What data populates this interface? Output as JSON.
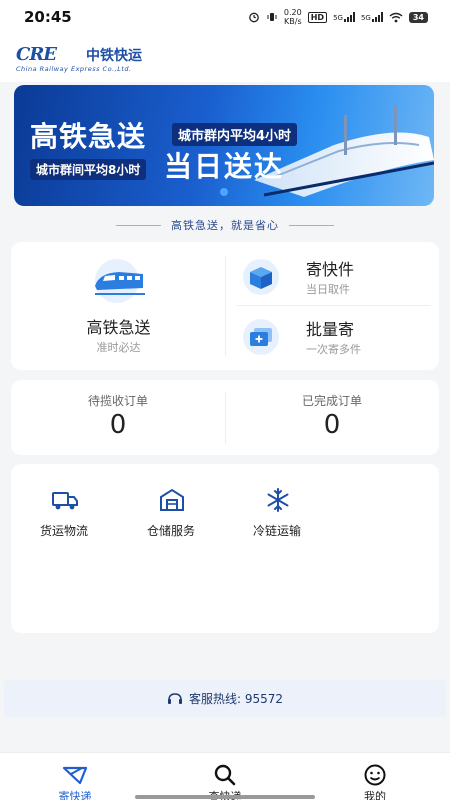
{
  "statusbar": {
    "time": "20:45",
    "net_speed_value": "0.20",
    "net_speed_unit": "KB/s",
    "hd_badge": "HD",
    "sim1": "5G",
    "sim2": "5G",
    "battery": "34"
  },
  "brand": {
    "logo_mark": "CRE",
    "name_cn": "中铁快运",
    "name_en": "China Railway Express Co.,Ltd."
  },
  "banner": {
    "headline": "高铁急送",
    "tag_within": "城市群内平均4小时",
    "tag_between": "城市群间平均8小时",
    "headline2": "当日送达",
    "slide_count": 1,
    "active_slide": 1
  },
  "slogan": "高铁急送，就是省心",
  "services": {
    "main": {
      "title": "高铁急送",
      "sub": "准时必达",
      "icon": "high-speed-train-icon"
    },
    "send": {
      "title": "寄快件",
      "sub": "当日取件",
      "icon": "package-box-icon"
    },
    "batch": {
      "title": "批量寄",
      "sub": "一次寄多件",
      "icon": "batch-stack-icon"
    }
  },
  "orders": {
    "pending_label": "待揽收订单",
    "pending_value": "0",
    "done_label": "已完成订单",
    "done_value": "0"
  },
  "more_services": [
    {
      "label": "货运物流",
      "icon": "truck-icon"
    },
    {
      "label": "仓储服务",
      "icon": "warehouse-icon"
    },
    {
      "label": "冷链运输",
      "icon": "snowflake-icon"
    }
  ],
  "hotline": {
    "text": "客服热线: 95572",
    "icon": "headset-icon"
  },
  "tabbar": [
    {
      "label": "寄快递",
      "icon": "send-icon",
      "active": true
    },
    {
      "label": "查快递",
      "icon": "search-icon",
      "active": false
    },
    {
      "label": "我的",
      "icon": "smiley-icon",
      "active": false
    }
  ],
  "colors": {
    "brand_blue": "#1e4fa6",
    "accent_blue": "#1f5fd1",
    "page_bg": "#f4f5f7"
  }
}
